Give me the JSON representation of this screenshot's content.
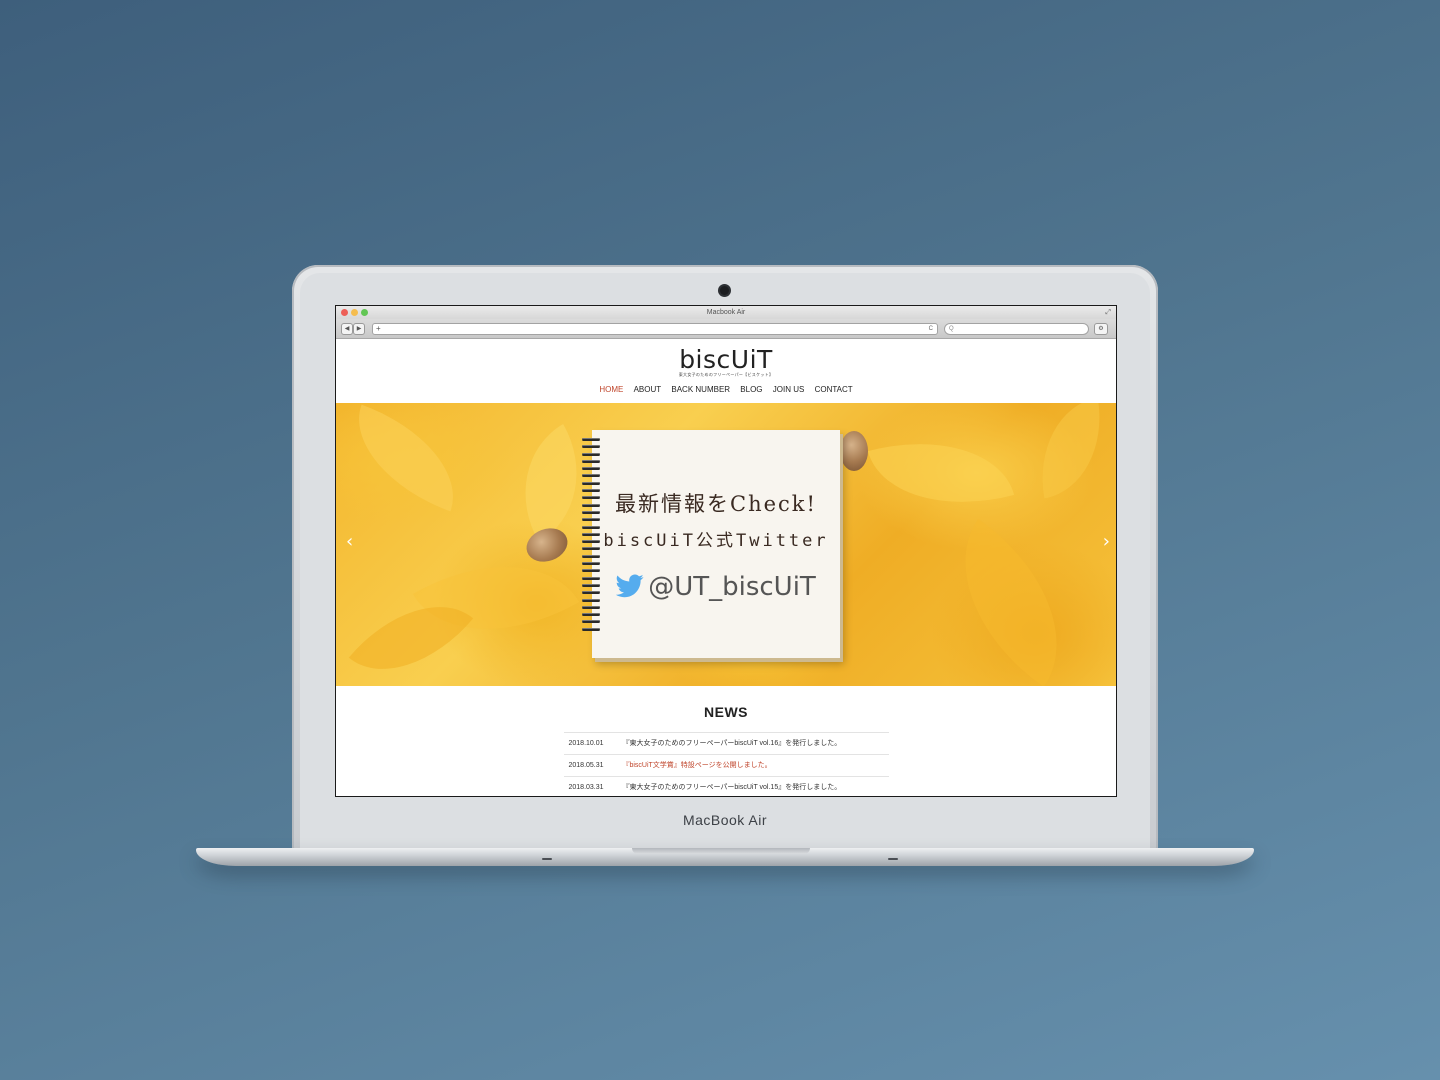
{
  "device": {
    "brand_label": "MacBook Air"
  },
  "browser": {
    "window_title": "Macbook Air",
    "back_label": "◀",
    "forward_label": "▶",
    "new_tab_label": "+",
    "reload_label": "C",
    "search_icon_label": "Q"
  },
  "site": {
    "logo": "biscUiT",
    "logo_sub": "東大女子のためのフリーペーパー【ビスケット】",
    "nav": [
      {
        "label": "HOME",
        "active": true
      },
      {
        "label": "ABOUT",
        "active": false
      },
      {
        "label": "BACK NUMBER",
        "active": false
      },
      {
        "label": "BLOG",
        "active": false
      },
      {
        "label": "JOIN US",
        "active": false
      },
      {
        "label": "CONTACT",
        "active": false
      }
    ]
  },
  "hero": {
    "prev_label": "‹",
    "next_label": "›",
    "line1": "最新情報をCheck!",
    "line2": "biscUiT公式Twitter",
    "handle": "@UT_biscUiT",
    "colors": {
      "twitter": "#55acee",
      "leaf": "#f4bd33"
    }
  },
  "news": {
    "title": "NEWS",
    "items": [
      {
        "date": "2018.10.01",
        "text": "『東大女子のためのフリーペーパーbiscUiT vol.16』を発行しました。"
      },
      {
        "date": "2018.05.31",
        "text": "『biscUiT文学賞』特設ページを公開しました。"
      },
      {
        "date": "2018.03.31",
        "text": "『東大女子のためのフリーペーパーbiscUiT vol.15』を発行しました。"
      }
    ]
  }
}
